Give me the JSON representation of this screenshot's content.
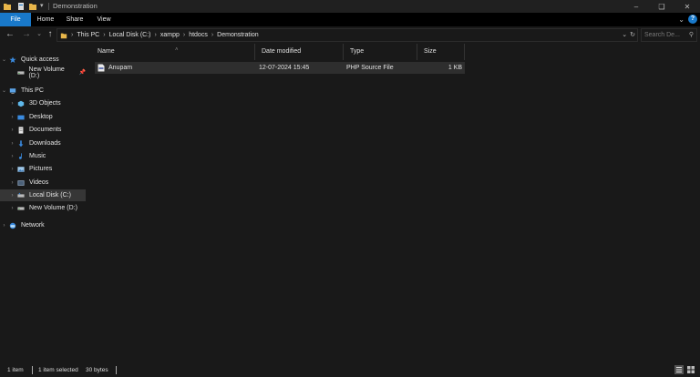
{
  "window": {
    "title": "Demonstration",
    "controls": [
      "minimize",
      "maximize",
      "close"
    ]
  },
  "ribbon": {
    "tabs": [
      "File",
      "Home",
      "Share",
      "View"
    ]
  },
  "address": {
    "breadcrumbs": [
      "This PC",
      "Local Disk (C:)",
      "xampp",
      "htdocs",
      "Demonstration"
    ],
    "search_placeholder": "Search De..."
  },
  "nav": {
    "items": [
      {
        "label": "Quick access",
        "icon": "star-icon"
      },
      {
        "label": "New Volume (D:)",
        "icon": "drive-icon",
        "pinned": true
      },
      {
        "label": "This PC",
        "icon": "pc-icon"
      },
      {
        "label": "3D Objects",
        "icon": "cube-icon"
      },
      {
        "label": "Desktop",
        "icon": "desktop-icon"
      },
      {
        "label": "Documents",
        "icon": "document-icon"
      },
      {
        "label": "Downloads",
        "icon": "download-icon"
      },
      {
        "label": "Music",
        "icon": "music-icon"
      },
      {
        "label": "Pictures",
        "icon": "picture-icon"
      },
      {
        "label": "Videos",
        "icon": "video-icon"
      },
      {
        "label": "Local Disk (C:)",
        "icon": "drive-icon",
        "selected": true
      },
      {
        "label": "New Volume (D:)",
        "icon": "drive-icon"
      },
      {
        "label": "Network",
        "icon": "network-icon"
      }
    ]
  },
  "columns": [
    "Name",
    "Date modified",
    "Type",
    "Size"
  ],
  "files": [
    {
      "name": "Anupam",
      "date": "12-07-2024 15:45",
      "type": "PHP Source File",
      "size": "1 KB"
    }
  ],
  "status": {
    "count": "1 item",
    "selected": "1 item selected",
    "size": "30 bytes"
  },
  "colors": {
    "accent": "#1979ca",
    "background": "#191919",
    "selection": "#2e2e2e"
  }
}
